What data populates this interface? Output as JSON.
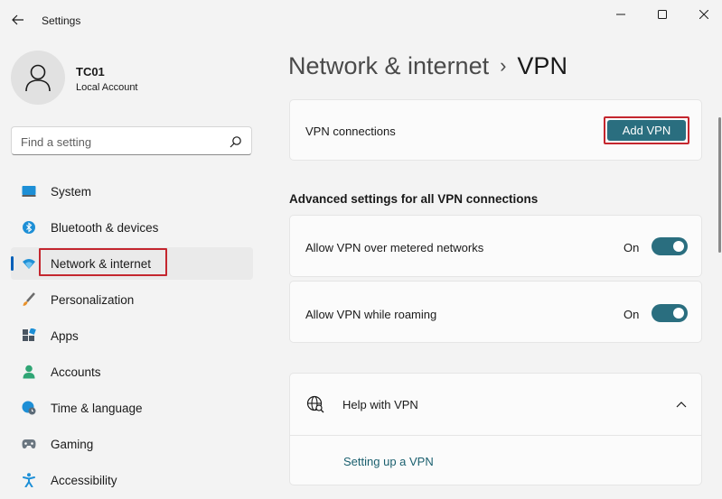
{
  "window": {
    "title": "Settings",
    "controls": [
      "minimize-icon",
      "maximize-icon",
      "close-icon"
    ]
  },
  "profile": {
    "name": "TC01",
    "account_type": "Local Account"
  },
  "search": {
    "placeholder": "Find a setting",
    "value": ""
  },
  "sidebar": {
    "items": [
      {
        "label": "System",
        "icon": "monitor-icon"
      },
      {
        "label": "Bluetooth & devices",
        "icon": "bluetooth-icon"
      },
      {
        "label": "Network & internet",
        "icon": "wifi-icon",
        "active": true
      },
      {
        "label": "Personalization",
        "icon": "brush-icon"
      },
      {
        "label": "Apps",
        "icon": "apps-icon"
      },
      {
        "label": "Accounts",
        "icon": "person-icon"
      },
      {
        "label": "Time & language",
        "icon": "globe-clock-icon"
      },
      {
        "label": "Gaming",
        "icon": "gamepad-icon"
      },
      {
        "label": "Accessibility",
        "icon": "accessibility-icon"
      }
    ]
  },
  "breadcrumb": {
    "parent": "Network & internet",
    "separator": "›",
    "current": "VPN"
  },
  "vpn_connections": {
    "label": "VPN connections",
    "button": "Add VPN"
  },
  "advanced": {
    "heading": "Advanced settings for all VPN connections",
    "settings": [
      {
        "label": "Allow VPN over metered networks",
        "state": "On",
        "enabled": true
      },
      {
        "label": "Allow VPN while roaming",
        "state": "On",
        "enabled": true
      }
    ]
  },
  "help": {
    "title": "Help with VPN",
    "icon": "globe-search-icon",
    "expanded": true,
    "links": [
      "Setting up a VPN"
    ]
  },
  "colors": {
    "accent": "#2a6e7f",
    "highlight_box": "#c4262e",
    "nav_indicator": "#005fb8"
  }
}
